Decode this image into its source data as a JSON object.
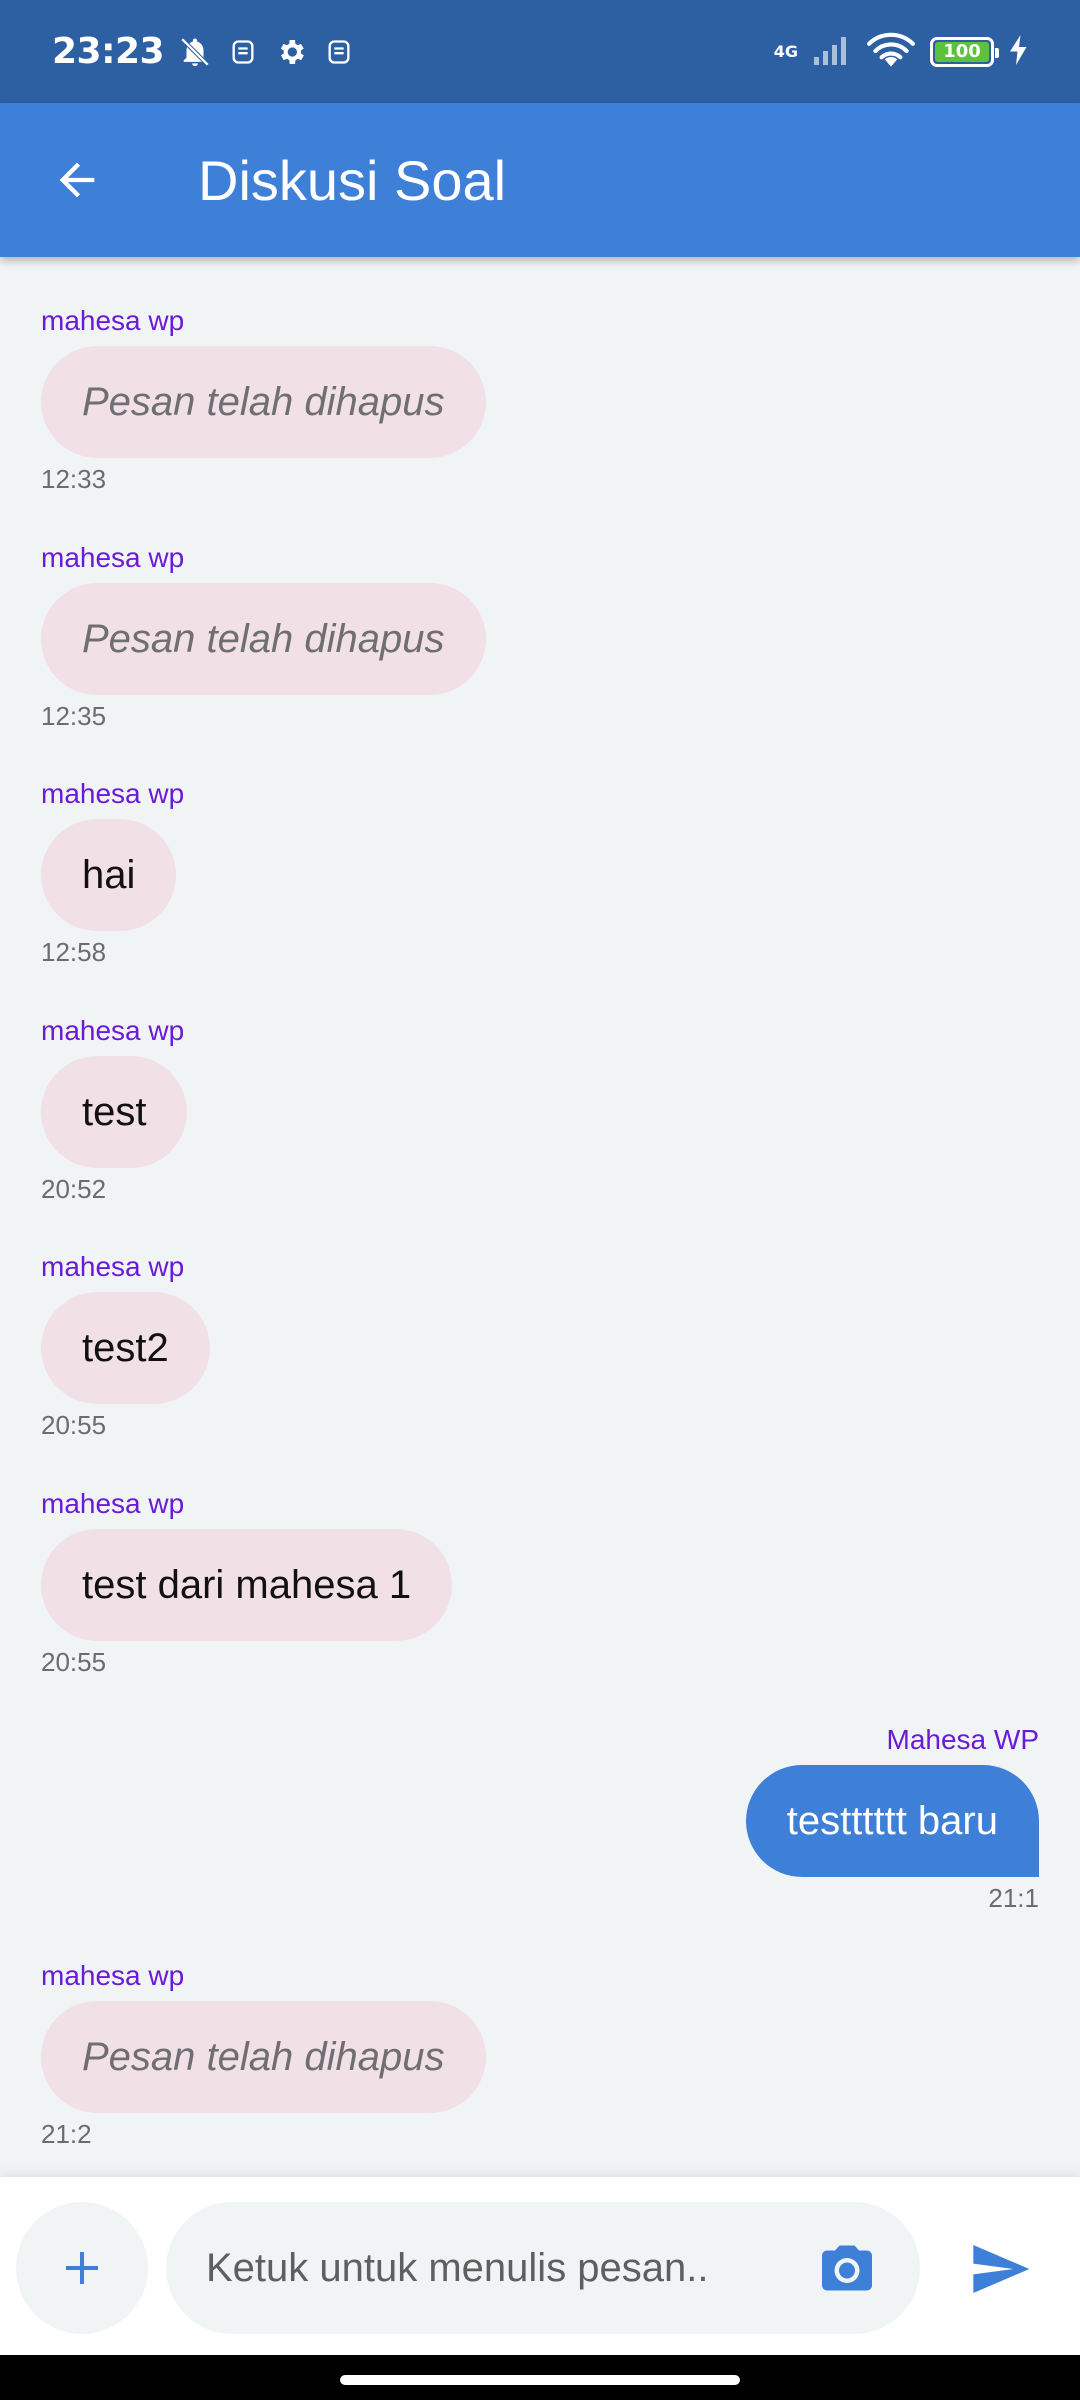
{
  "status_bar": {
    "time": "23:23",
    "network": "4G",
    "battery": "100",
    "battery_color": "#5cc23e"
  },
  "app_bar": {
    "title": "Diskusi Soal",
    "background": "#3e7fd7"
  },
  "messages": [
    {
      "sender": "mahesa wp",
      "text": "Pesan telah dihapus",
      "time": "12:33",
      "deleted": true,
      "own": false
    },
    {
      "sender": "mahesa wp",
      "text": "Pesan telah dihapus",
      "time": "12:35",
      "deleted": true,
      "own": false
    },
    {
      "sender": "mahesa wp",
      "text": "hai",
      "time": "12:58",
      "deleted": false,
      "own": false
    },
    {
      "sender": "mahesa wp",
      "text": "test",
      "time": "20:52",
      "deleted": false,
      "own": false
    },
    {
      "sender": "mahesa wp",
      "text": "test2",
      "time": "20:55",
      "deleted": false,
      "own": false
    },
    {
      "sender": "mahesa wp",
      "text": "test dari mahesa 1",
      "time": "20:55",
      "deleted": false,
      "own": false
    },
    {
      "sender": "Mahesa WP",
      "text": "testttttt baru",
      "time": "21:1",
      "deleted": false,
      "own": true
    },
    {
      "sender": "mahesa wp",
      "text": "Pesan telah dihapus",
      "time": "21:2",
      "deleted": true,
      "own": false
    }
  ],
  "composer": {
    "placeholder": "Ketuk untuk menulis pesan.."
  },
  "icons": {
    "back": "arrow-left-icon",
    "add": "plus-icon",
    "camera": "camera-icon",
    "send": "send-icon"
  },
  "colors": {
    "accent": "#3e7fd7",
    "sender_name": "#6a1bd6",
    "incoming_bubble": "#f1e1e6",
    "background": "#f1f4f5"
  }
}
